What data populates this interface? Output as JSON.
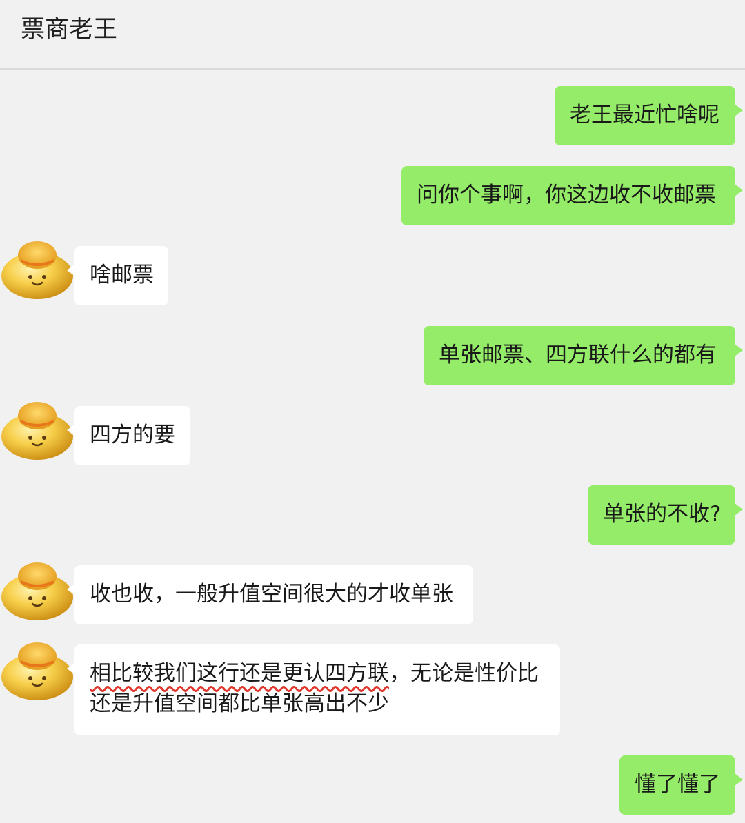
{
  "header": {
    "title": "票商老王"
  },
  "messages": [
    {
      "side": "me",
      "text": "老王最近忙啥呢"
    },
    {
      "side": "me",
      "text": "问你个事啊，你这边收不收邮票"
    },
    {
      "side": "them",
      "text": "啥邮票"
    },
    {
      "side": "me",
      "text": "单张邮票、四方联什么的都有"
    },
    {
      "side": "them",
      "text": "四方的要"
    },
    {
      "side": "me",
      "text": "单张的不收?"
    },
    {
      "side": "them",
      "text": "收也收，一般升值空间很大的才收单张"
    },
    {
      "side": "them",
      "line1_underlined": "相比较我们这行还是更认四方联",
      "line1_rest": "，无论是性价比",
      "line2": "还是升值空间都比单张高出不少"
    },
    {
      "side": "me",
      "text": "懂了懂了"
    }
  ],
  "colors": {
    "background": "#f1f1f1",
    "my_bubble": "#95ec69",
    "their_bubble": "#ffffff",
    "underline": "#e0362b",
    "avatar": "#f5c53a"
  },
  "icons": {
    "avatar": "gold-ingot-mascot-icon"
  }
}
